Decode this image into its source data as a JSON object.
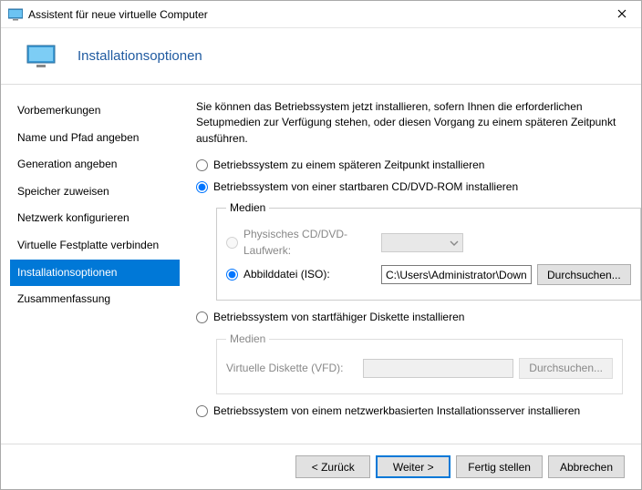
{
  "window": {
    "title": "Assistent für neue virtuelle Computer",
    "close_label": "×"
  },
  "header": {
    "title": "Installationsoptionen"
  },
  "sidebar": {
    "items": [
      {
        "label": "Vorbemerkungen"
      },
      {
        "label": "Name und Pfad angeben"
      },
      {
        "label": "Generation angeben"
      },
      {
        "label": "Speicher zuweisen"
      },
      {
        "label": "Netzwerk konfigurieren"
      },
      {
        "label": "Virtuelle Festplatte verbinden"
      },
      {
        "label": "Installationsoptionen"
      },
      {
        "label": "Zusammenfassung"
      }
    ],
    "selected_index": 6
  },
  "content": {
    "intro": "Sie können das Betriebssystem jetzt installieren, sofern Ihnen die erforderlichen Setupmedien zur Verfügung stehen, oder diesen Vorgang zu einem späteren Zeitpunkt ausführen.",
    "option_later": "Betriebssystem zu einem späteren Zeitpunkt installieren",
    "option_cddvd": "Betriebssystem von einer startbaren CD/DVD-ROM installieren",
    "option_floppy": "Betriebssystem von startfähiger Diskette installieren",
    "option_network": "Betriebssystem von einem netzwerkbasierten Installationsserver installieren",
    "selected_main": "cddvd",
    "cddvd": {
      "legend": "Medien",
      "phys_label": "Physisches CD/DVD-Laufwerk:",
      "iso_label": "Abbilddatei (ISO):",
      "iso_value": "C:\\Users\\Administrator\\Downloads\\spii",
      "browse": "Durchsuchen...",
      "selected_sub": "iso"
    },
    "floppy": {
      "legend": "Medien",
      "vfd_label": "Virtuelle Diskette (VFD):",
      "browse": "Durchsuchen..."
    }
  },
  "footer": {
    "back": "< Zurück",
    "next": "Weiter >",
    "finish": "Fertig stellen",
    "cancel": "Abbrechen"
  }
}
